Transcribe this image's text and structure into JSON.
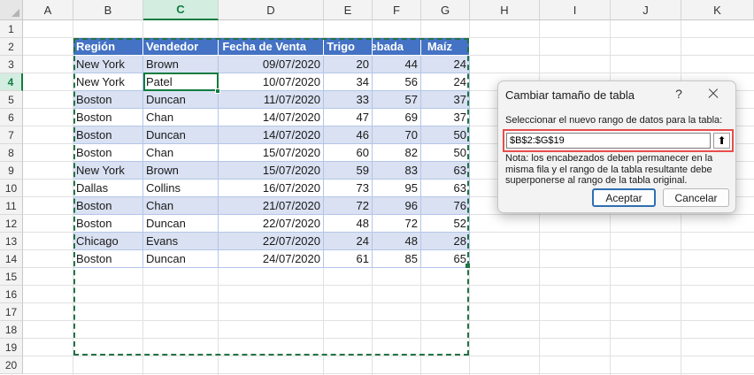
{
  "columns": [
    "A",
    "B",
    "C",
    "D",
    "E",
    "F",
    "G",
    "H",
    "I",
    "J",
    "K"
  ],
  "rows": [
    "1",
    "2",
    "3",
    "4",
    "5",
    "6",
    "7",
    "8",
    "9",
    "10",
    "11",
    "12",
    "13",
    "14",
    "15",
    "16",
    "17",
    "18",
    "19",
    "20"
  ],
  "table": {
    "headers": [
      "Región",
      "Vendedor",
      "Fecha de Venta",
      "Trigo",
      "Cebada",
      "Maíz"
    ],
    "rows": [
      [
        "New York",
        "Brown",
        "09/07/2020",
        "20",
        "44",
        "24"
      ],
      [
        "New York",
        "Patel",
        "10/07/2020",
        "34",
        "56",
        "24"
      ],
      [
        "Boston",
        "Duncan",
        "11/07/2020",
        "33",
        "57",
        "37"
      ],
      [
        "Boston",
        "Chan",
        "14/07/2020",
        "47",
        "69",
        "37"
      ],
      [
        "Boston",
        "Duncan",
        "14/07/2020",
        "46",
        "70",
        "50"
      ],
      [
        "Boston",
        "Chan",
        "15/07/2020",
        "60",
        "82",
        "50"
      ],
      [
        "New York",
        "Brown",
        "15/07/2020",
        "59",
        "83",
        "63"
      ],
      [
        "Dallas",
        "Collins",
        "16/07/2020",
        "73",
        "95",
        "63"
      ],
      [
        "Boston",
        "Chan",
        "21/07/2020",
        "72",
        "96",
        "76"
      ],
      [
        "Boston",
        "Duncan",
        "22/07/2020",
        "48",
        "72",
        "52"
      ],
      [
        "Chicago",
        "Evans",
        "22/07/2020",
        "24",
        "48",
        "28"
      ],
      [
        "Boston",
        "Duncan",
        "24/07/2020",
        "61",
        "85",
        "65"
      ]
    ]
  },
  "dialog": {
    "title": "Cambiar tamaño de tabla",
    "help": "?",
    "prompt": "Seleccionar el nuevo rango de datos para la tabla:",
    "range_value": "$B$2:$G$19",
    "collapse_glyph": "⬆",
    "note": "Nota: los encabezados deben permanecer en la misma fila y el rango de la tabla resultante debe superponerse al rango de la tabla original.",
    "ok_label": "Aceptar",
    "cancel_label": "Cancelar"
  },
  "colors": {
    "header_fill": "#4472c4",
    "band_fill": "#d9e1f2",
    "selection": "#107c41",
    "highlight": "#e84c4c"
  }
}
